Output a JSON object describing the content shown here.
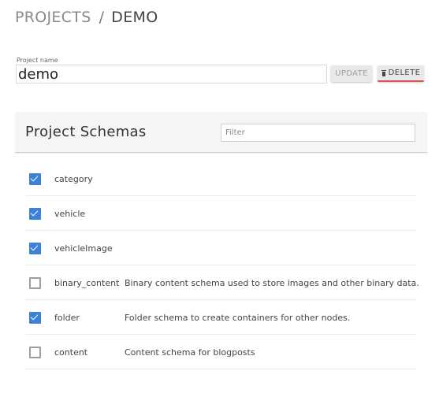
{
  "breadcrumb": {
    "root": "PROJECTS",
    "separator": "/",
    "current": "DEMO"
  },
  "project": {
    "name_label": "Project name",
    "name_value": "demo",
    "update_label": "UPDATE",
    "delete_label": "DELETE",
    "delete_icon": "trash-icon",
    "delete_accent": "#d9534f"
  },
  "schemas": {
    "title": "Project Schemas",
    "filter_placeholder": "Filter",
    "checkbox_color": "#3b82d6",
    "items": [
      {
        "name": "category",
        "description": "",
        "checked": true
      },
      {
        "name": "vehicle",
        "description": "",
        "checked": true
      },
      {
        "name": "vehicleImage",
        "description": "",
        "checked": true
      },
      {
        "name": "binary_content",
        "description": "Binary content schema used to store images and other binary data.",
        "checked": false
      },
      {
        "name": "folder",
        "description": "Folder schema to create containers for other nodes.",
        "checked": true
      },
      {
        "name": "content",
        "description": "Content schema for blogposts",
        "checked": false
      }
    ]
  }
}
